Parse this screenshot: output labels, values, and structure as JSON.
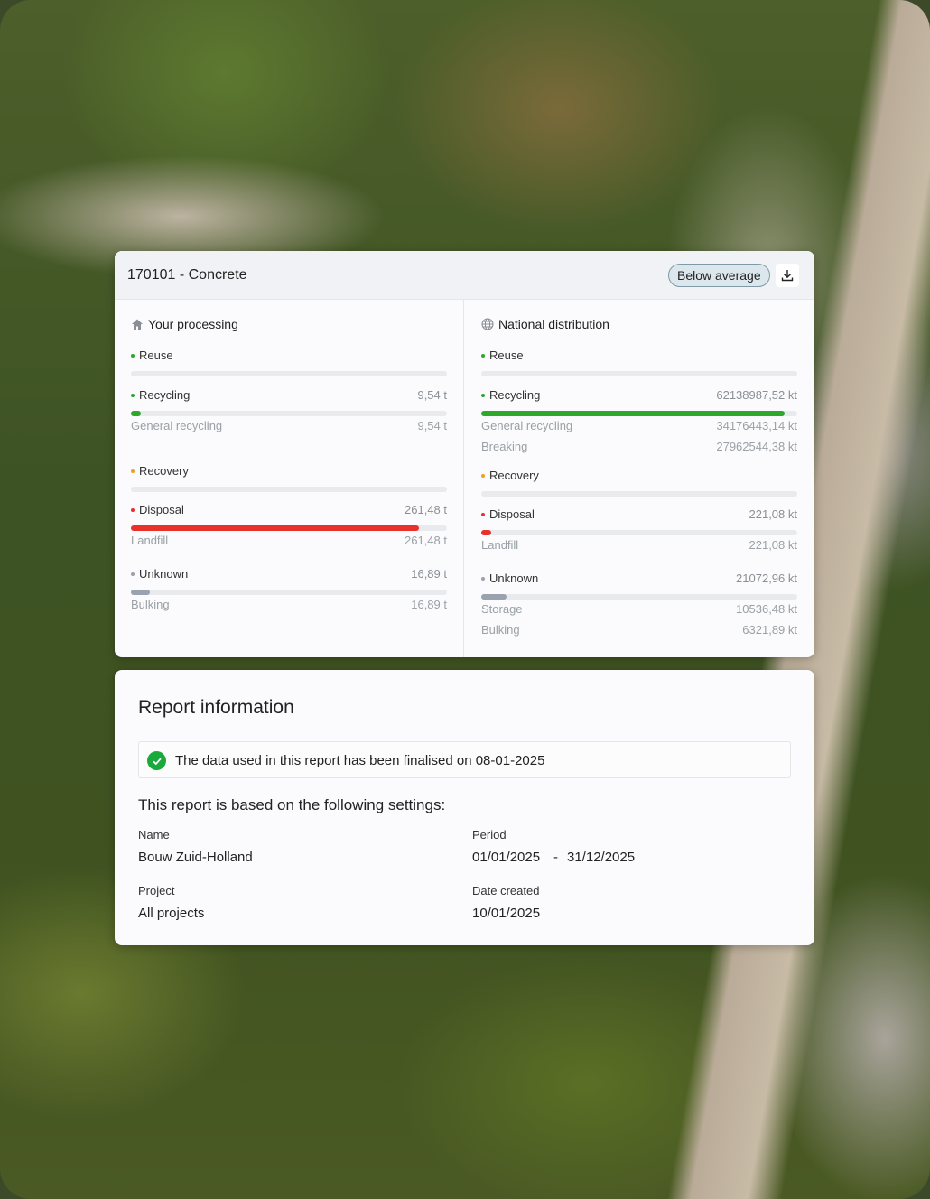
{
  "colors": {
    "green": "#2ea82a",
    "orange": "#f0a020",
    "red": "#e8312a",
    "gray": "#9aa2b0",
    "track": "#e9eaee",
    "badge_bg": "#dbe7ec",
    "success": "#1aaa3c"
  },
  "material_card": {
    "title": "170101 - Concrete",
    "badge": "Below average",
    "download_icon": "download-icon",
    "left": {
      "icon": "home-icon",
      "heading": "Your processing",
      "reuse": {
        "label": "Reuse",
        "value": "",
        "fill": 0
      },
      "recycling": {
        "label": "Recycling",
        "value": "9,54 t",
        "fill": 0.03
      },
      "recycling_sub": [
        {
          "label": "General recycling",
          "value": "9,54 t"
        }
      ],
      "recovery": {
        "label": "Recovery",
        "value": "",
        "fill": 0
      },
      "disposal": {
        "label": "Disposal",
        "value": "261,48 t",
        "fill": 0.91
      },
      "disposal_sub": [
        {
          "label": "Landfill",
          "value": "261,48 t"
        }
      ],
      "unknown": {
        "label": "Unknown",
        "value": "16,89 t",
        "fill": 0.06
      },
      "unknown_sub": [
        {
          "label": "Bulking",
          "value": "16,89 t"
        }
      ]
    },
    "right": {
      "icon": "globe-icon",
      "heading": "National distribution",
      "reuse": {
        "label": "Reuse",
        "value": "",
        "fill": 0
      },
      "recycling": {
        "label": "Recycling",
        "value": "62138987,52 kt",
        "fill": 0.96
      },
      "recycling_sub": [
        {
          "label": "General recycling",
          "value": "34176443,14 kt"
        },
        {
          "label": "Breaking",
          "value": "27962544,38 kt"
        }
      ],
      "recovery": {
        "label": "Recovery",
        "value": "",
        "fill": 0
      },
      "disposal": {
        "label": "Disposal",
        "value": "221,08 kt",
        "fill": 0.03
      },
      "disposal_sub": [
        {
          "label": "Landfill",
          "value": "221,08 kt"
        }
      ],
      "unknown": {
        "label": "Unknown",
        "value": "21072,96 kt",
        "fill": 0.08
      },
      "unknown_sub": [
        {
          "label": "Storage",
          "value": "10536,48 kt"
        },
        {
          "label": "Bulking",
          "value": "6321,89 kt"
        }
      ]
    }
  },
  "report": {
    "title": "Report information",
    "notice_icon": "check-circle-icon",
    "notice": "The data used in this report has been finalised on 08-01-2025",
    "settings_heading": "This report is based on the following settings:",
    "name_label": "Name",
    "name_value": "Bouw Zuid-Holland",
    "period_label": "Period",
    "period_start": "01/01/2025",
    "period_sep": "-",
    "period_end": "31/12/2025",
    "project_label": "Project",
    "project_value": "All projects",
    "date_label": "Date created",
    "date_value": "10/01/2025"
  }
}
